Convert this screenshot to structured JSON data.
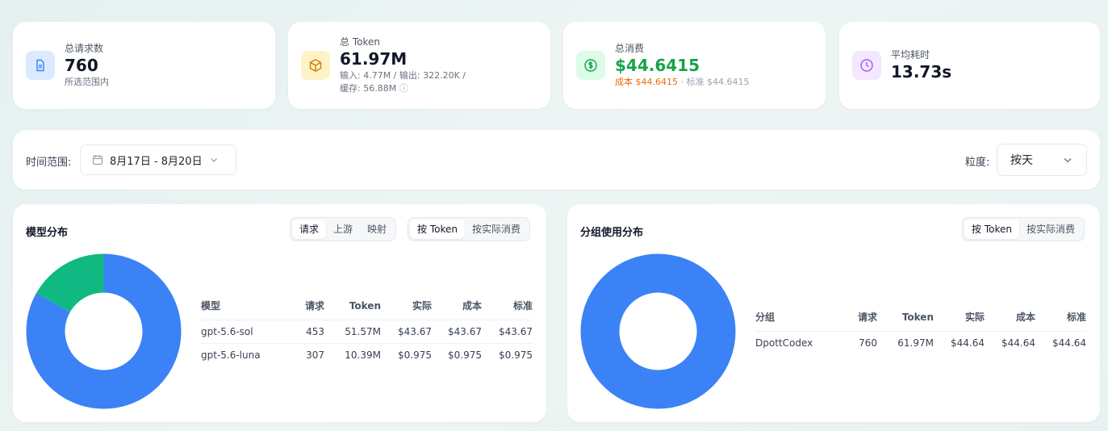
{
  "stats": {
    "requests": {
      "label": "总请求数",
      "value": "760",
      "sub": "所选范围内",
      "icon": "document-icon",
      "color": "#3b82f6"
    },
    "tokens": {
      "label": "总 Token",
      "value": "61.97M",
      "sub1": "输入: 4.77M / 输出: 322.20K /",
      "sub2": "缓存: 56.88M",
      "info_glyph": "ⓘ",
      "icon": "cube-icon",
      "color": "#f59e0b"
    },
    "cost": {
      "label": "总消费",
      "value": "$44.6415",
      "cost_part": "成本 $44.6415",
      "sep": " · ",
      "std_part": "标准 $44.6415",
      "icon": "dollar-icon",
      "color": "#16a34a"
    },
    "latency": {
      "label": "平均耗时",
      "value": "13.73s",
      "icon": "clock-icon",
      "color": "#a855f7"
    }
  },
  "filter": {
    "range_label": "时间范围:",
    "range_value": "8月17日 - 8月20日",
    "granularity_label": "粒度:",
    "granularity_value": "按天"
  },
  "model_panel": {
    "title": "模型分布",
    "view_tabs": [
      "请求",
      "上游",
      "映射"
    ],
    "view_active": 0,
    "metric_tabs": [
      "按 Token",
      "按实际消费"
    ],
    "metric_active": 0,
    "columns": [
      "模型",
      "请求",
      "Token",
      "实际",
      "成本",
      "标准"
    ],
    "rows": [
      {
        "name": "gpt-5.6-sol",
        "requests": "453",
        "token": "51.57M",
        "actual": "$43.67",
        "cost": "$43.67",
        "standard": "$43.67"
      },
      {
        "name": "gpt-5.6-luna",
        "requests": "307",
        "token": "10.39M",
        "actual": "$0.975",
        "cost": "$0.975",
        "standard": "$0.975"
      }
    ]
  },
  "group_panel": {
    "title": "分组使用分布",
    "metric_tabs": [
      "按 Token",
      "按实际消费"
    ],
    "metric_active": 0,
    "columns": [
      "分组",
      "请求",
      "Token",
      "实际",
      "成本",
      "标准"
    ],
    "rows": [
      {
        "name": "DpottCodex",
        "requests": "760",
        "token": "61.97M",
        "actual": "$44.64",
        "cost": "$44.64",
        "standard": "$44.64"
      }
    ]
  },
  "chart_data": [
    {
      "type": "pie",
      "categories": [
        "gpt-5.6-sol",
        "gpt-5.6-luna"
      ],
      "values": [
        51.57,
        10.39
      ],
      "unit": "M tokens",
      "colors": [
        "#3b82f6",
        "#10b981"
      ]
    },
    {
      "type": "pie",
      "categories": [
        "DpottCodex"
      ],
      "values": [
        61.97
      ],
      "unit": "M tokens",
      "colors": [
        "#3b82f6"
      ]
    }
  ]
}
